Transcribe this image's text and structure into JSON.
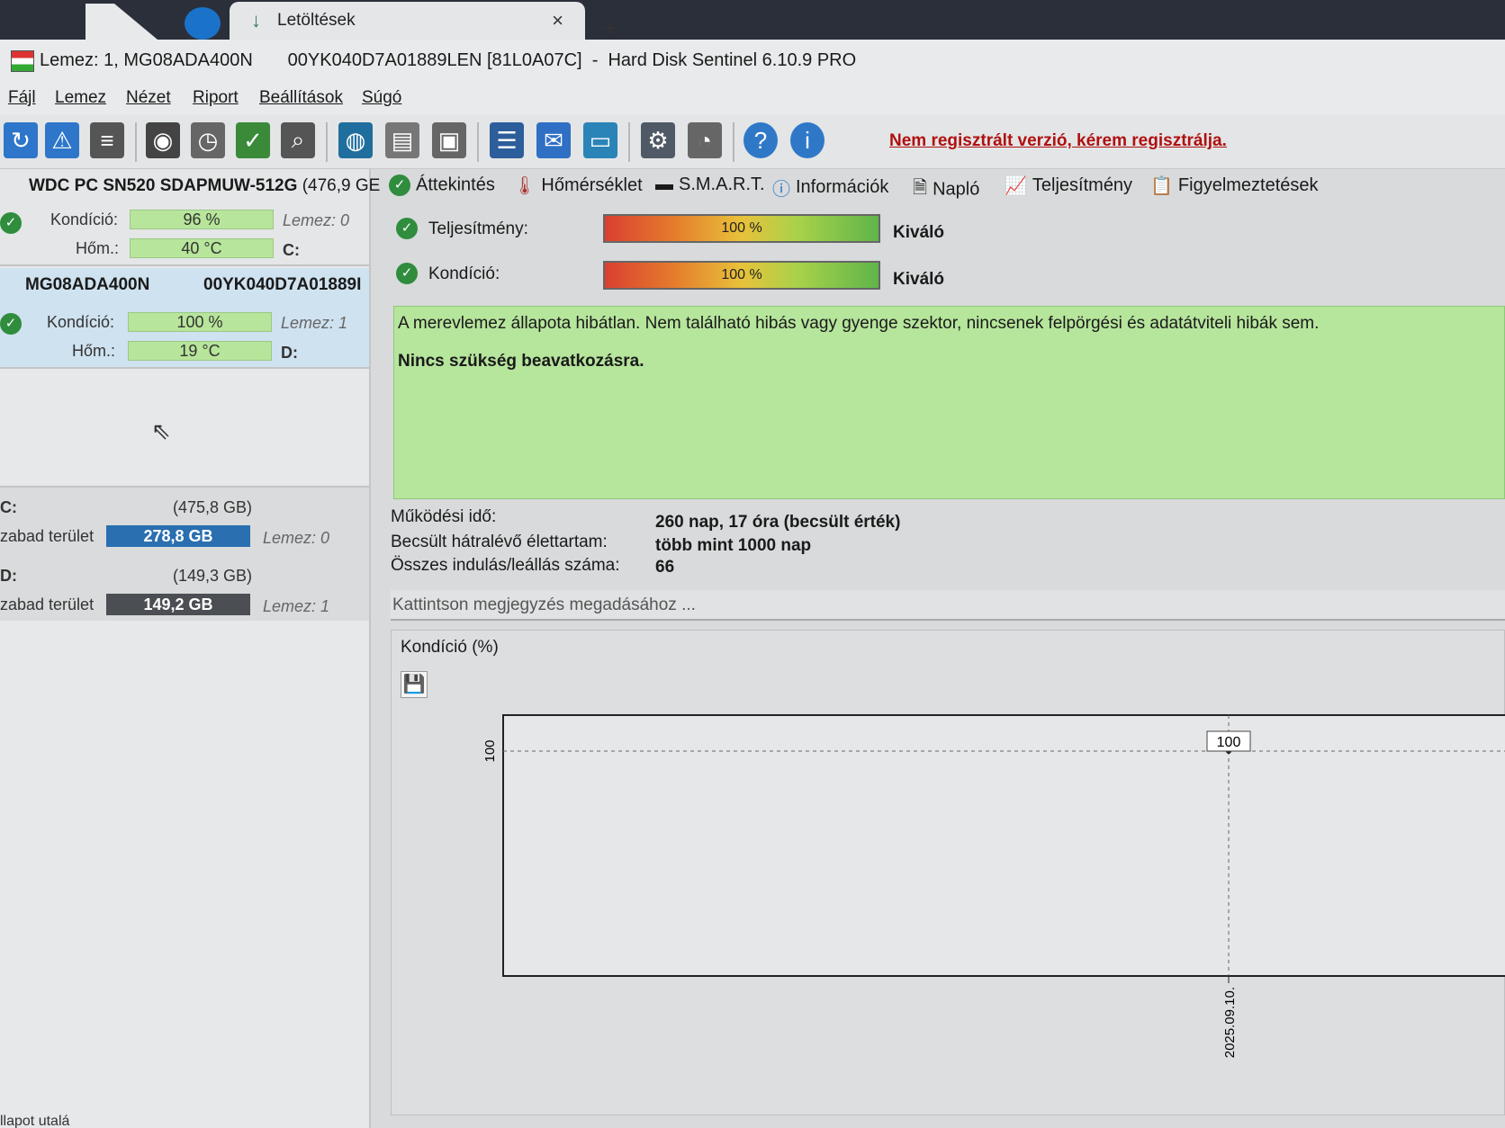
{
  "browser": {
    "tab_label": "Letöltések",
    "close_glyph": "×",
    "new_tab_glyph": "+"
  },
  "window": {
    "title": "Lemez: 1, MG08ADA400N       00YK040D7A01889LEN [81L0A07C]  -  Hard Disk Sentinel 6.10.9 PRO"
  },
  "menu": {
    "items": [
      "Fájl",
      "Lemez",
      "Nézet",
      "Riport",
      "Beállítások",
      "Súgó"
    ]
  },
  "toolbar": {
    "icons": [
      "refresh-icon",
      "refresh-warning-icon",
      "disk-list-icon",
      "disk-surface-icon",
      "disk-clock-icon",
      "disk-check-icon",
      "disk-search-icon",
      "globe-disk-icon",
      "network-disk-icon",
      "backup-icon",
      "report-icon",
      "mail-icon",
      "monitor-icon",
      "settings-icon",
      "sound-icon",
      "help-icon",
      "info-icon"
    ],
    "unregistered_notice": "Nem regisztrált verzió, kérem regisztrálja."
  },
  "disks": [
    {
      "title": "WDC PC SN520 SDAPMUW-512G",
      "size": "(476,9 GE",
      "condition_label": "Kondíció:",
      "condition_value": "96 %",
      "condition_pct": 96,
      "temp_label": "Hőm.:",
      "temp_value": "40 °C",
      "disk_index": "Lemez: 0",
      "drive_letter": "C:"
    },
    {
      "title": "MG08ADA400N",
      "serial": "00YK040D7A01889I",
      "condition_label": "Kondíció:",
      "condition_value": "100 %",
      "condition_pct": 100,
      "temp_label": "Hőm.:",
      "temp_value": "19 °C",
      "disk_index": "Lemez: 1",
      "drive_letter": "D:"
    }
  ],
  "volumes": [
    {
      "letter": "C:",
      "size": "(475,8 GB)",
      "free_label": "zabad terület",
      "free_value": "278,8 GB",
      "disk_index": "Lemez: 0",
      "color": "#2a6fb0"
    },
    {
      "letter": "D:",
      "size": "(149,3 GB)",
      "free_label": "zabad terület",
      "free_value": "149,2 GB",
      "disk_index": "Lemez: 1",
      "color": "#4b4e52"
    }
  ],
  "footer_fragment": "llapot utalá",
  "tabs": [
    "Áttekintés",
    "Hőmérséklet",
    "S.M.A.R.T.",
    "Információk",
    "Napló",
    "Teljesítmény",
    "Figyelmeztetések"
  ],
  "overview": {
    "performance": {
      "label": "Teljesítmény:",
      "value": "100 %",
      "pct": 100,
      "rating": "Kiváló"
    },
    "condition": {
      "label": "Kondíció:",
      "value": "100 %",
      "pct": 100,
      "rating": "Kiváló"
    },
    "status_text": "A merevlemez állapota hibátlan. Nem található hibás vagy gyenge szektor, nincsenek felpörgési és adatátviteli hibák sem.",
    "status_action": "Nincs szükség beavatkozásra.",
    "info": [
      {
        "label": "Működési idő:",
        "value": "260 nap, 17 óra (becsült érték)"
      },
      {
        "label": "Becsült hátralévő élettartam:",
        "value": "több mint 1000 nap"
      },
      {
        "label": "Összes indulás/leállás száma:",
        "value": "66"
      }
    ],
    "note_placeholder": "Kattintson megjegyzés megadásához ..."
  },
  "chart_data": {
    "type": "line",
    "title": "Kondíció  (%)",
    "x": [
      "2025.09.10."
    ],
    "series": [
      {
        "values": [
          100
        ]
      }
    ],
    "ytick_labels": [
      "100"
    ],
    "point_labels": [
      "100"
    ],
    "grid": true
  }
}
